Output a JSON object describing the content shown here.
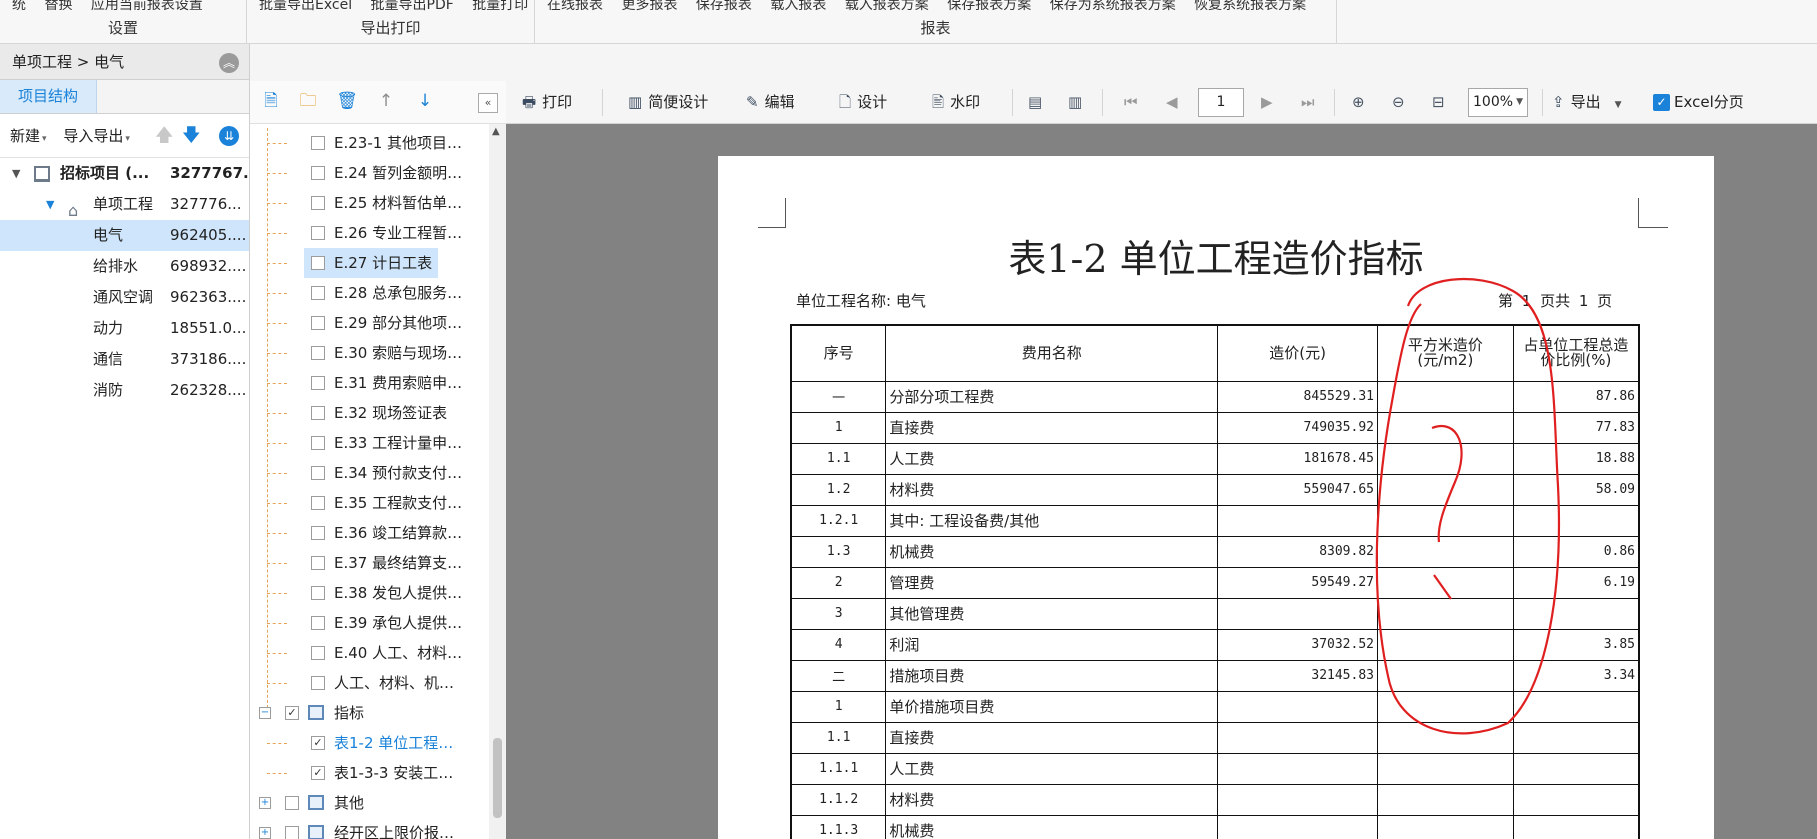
{
  "ribbon": {
    "groups": [
      {
        "name": "设置",
        "items": [
          "统",
          "替换",
          "应用当前报表设置"
        ]
      },
      {
        "name": "导出打印",
        "items": [
          "批量导出Excel",
          "批量导出PDF",
          "批量打印"
        ]
      },
      {
        "name": "报表",
        "items": [
          "在线报表",
          "更多报表",
          "保存报表",
          "载入报表",
          "载入报表方案",
          "保存报表方案",
          "保存为系统报表方案",
          "恢复系统报表方案"
        ]
      }
    ]
  },
  "left": {
    "breadcrumb": "单项工程 > 电气",
    "tab": "项目结构",
    "toolbar": {
      "new": "新建",
      "import_export": "导入导出"
    },
    "tree": [
      {
        "name": "招标项目 (...",
        "value": "3277767..."
      },
      {
        "name": "单项工程",
        "value": "327776..."
      },
      {
        "name": "电气",
        "value": "962405...."
      },
      {
        "name": "给排水",
        "value": "698932...."
      },
      {
        "name": "通风空调",
        "value": "962363...."
      },
      {
        "name": "动力",
        "value": "18551.0..."
      },
      {
        "name": "通信",
        "value": "373186...."
      },
      {
        "name": "消防",
        "value": "262328...."
      }
    ]
  },
  "report_tree": {
    "items": [
      {
        "label": "E.23-1 其他项目…",
        "checked": false
      },
      {
        "label": "E.24 暂列金额明…",
        "checked": false
      },
      {
        "label": "E.25 材料暂估单…",
        "checked": false
      },
      {
        "label": "E.26 专业工程暂…",
        "checked": false
      },
      {
        "label": "E.27 计日工表",
        "checked": false
      },
      {
        "label": "E.28 总承包服务…",
        "checked": false
      },
      {
        "label": "E.29 部分其他项…",
        "checked": false
      },
      {
        "label": "E.30 索赔与现场…",
        "checked": false
      },
      {
        "label": "E.31 费用索赔申…",
        "checked": false
      },
      {
        "label": "E.32 现场签证表",
        "checked": false
      },
      {
        "label": "E.33 工程计量申…",
        "checked": false
      },
      {
        "label": "E.34 预付款支付…",
        "checked": false
      },
      {
        "label": "E.35 工程款支付…",
        "checked": false
      },
      {
        "label": "E.36 竣工结算款…",
        "checked": false
      },
      {
        "label": "E.37 最终结算支…",
        "checked": false
      },
      {
        "label": "E.38 发包人提供…",
        "checked": false
      },
      {
        "label": "E.39 承包人提供…",
        "checked": false
      },
      {
        "label": "E.40 人工、材料…",
        "checked": false
      },
      {
        "label": "人工、材料、机…",
        "checked": false
      }
    ],
    "group_index": {
      "label": "指标",
      "checked": true
    },
    "index_items": [
      {
        "label": "表1-2 单位工程…",
        "checked": true
      },
      {
        "label": "表1-3-3 安装工…",
        "checked": true
      }
    ],
    "group_other": {
      "label": "其他",
      "checked": false
    },
    "group_last": {
      "label": "经开区上限价报…",
      "checked": false
    }
  },
  "preview_toolbar": {
    "print": "打印",
    "simple_design": "简便设计",
    "edit": "编辑",
    "design": "设计",
    "watermark": "水印",
    "page": "1",
    "zoom": "100%",
    "export": "导出",
    "excel_paging": "Excel分页"
  },
  "report": {
    "title": "表1-2 单位工程造价指标",
    "unit_label": "单位工程名称: 电气",
    "page_info": "第 1 页共 1 页",
    "columns": [
      "序号",
      "费用名称",
      "造价(元)",
      "平方米造价\n(元/m2)",
      "占单位工程总造\n价比例(%)"
    ],
    "rows": [
      [
        "一",
        "分部分项工程费",
        "845529.31",
        "",
        "87.86"
      ],
      [
        "1",
        "直接费",
        "749035.92",
        "",
        "77.83"
      ],
      [
        "1.1",
        "人工费",
        "181678.45",
        "",
        "18.88"
      ],
      [
        "1.2",
        "材料费",
        "559047.65",
        "",
        "58.09"
      ],
      [
        "1.2.1",
        "其中: 工程设备费/其他",
        "",
        "",
        ""
      ],
      [
        "1.3",
        "机械费",
        "8309.82",
        "",
        "0.86"
      ],
      [
        "2",
        "管理费",
        "59549.27",
        "",
        "6.19"
      ],
      [
        "3",
        "其他管理费",
        "",
        "",
        ""
      ],
      [
        "4",
        "利润",
        "37032.52",
        "",
        "3.85"
      ],
      [
        "二",
        "措施项目费",
        "32145.83",
        "",
        "3.34"
      ],
      [
        "1",
        "单价措施项目费",
        "",
        "",
        ""
      ],
      [
        "1.1",
        "直接费",
        "",
        "",
        ""
      ],
      [
        "1.1.1",
        "人工费",
        "",
        "",
        ""
      ],
      [
        "1.1.2",
        "材料费",
        "",
        "",
        ""
      ],
      [
        "1.1.3",
        "机械费",
        "",
        "",
        ""
      ]
    ]
  },
  "colors": {
    "accent": "#1a82d8",
    "annotation": "#e02020",
    "selection": "#cfe5fb"
  }
}
